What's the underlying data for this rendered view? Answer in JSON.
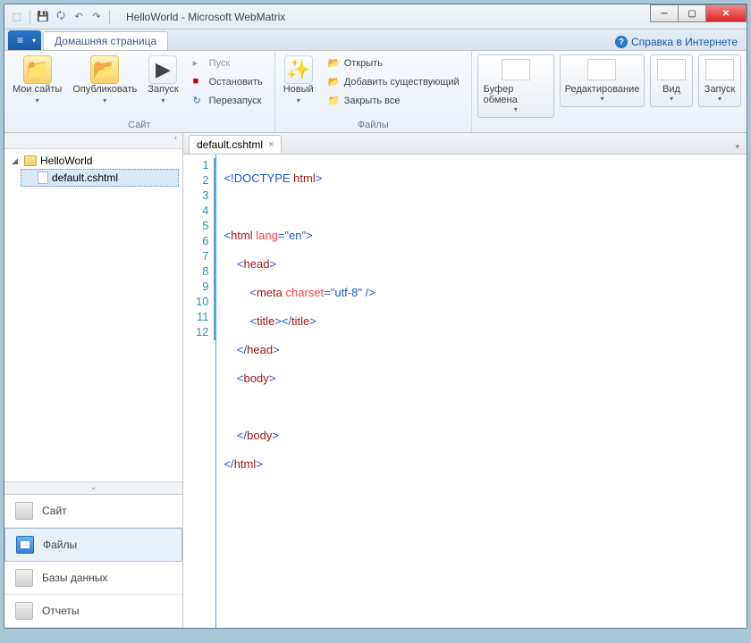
{
  "title": "HelloWorld - Microsoft WebMatrix",
  "ribbon_tab": "Домашняя страница",
  "help": "Справка в Интернете",
  "groups": {
    "site": {
      "label": "Сайт",
      "my_sites": "Мои сайты",
      "publish": "Опубликовать",
      "run": "Запуск",
      "start": "Пуск",
      "stop": "Остановить",
      "restart": "Перезапуск"
    },
    "files": {
      "label": "Файлы",
      "new": "Новый",
      "open": "Открыть",
      "add_existing": "Добавить существующий",
      "close_all": "Закрыть все"
    },
    "clipboard": "Буфер обмена",
    "editing": "Редактирование",
    "view": "Вид",
    "launch": "Запуск"
  },
  "tree": {
    "root": "HelloWorld",
    "file": "default.cshtml"
  },
  "nav": {
    "site": "Сайт",
    "files": "Файлы",
    "db": "Базы данных",
    "reports": "Отчеты"
  },
  "tab": {
    "name": "default.cshtml"
  },
  "code": {
    "lines": [
      "1",
      "2",
      "3",
      "4",
      "5",
      "6",
      "7",
      "8",
      "9",
      "10",
      "11",
      "12"
    ],
    "l1_a": "<!",
    "l1_b": "DOCTYPE",
    "l1_c": " html",
    "l1_d": ">",
    "l3_a": "<",
    "l3_b": "html",
    "l3_c": " lang",
    "l3_d": "=",
    "l3_e": "\"en\"",
    "l3_f": ">",
    "l4_a": "    <",
    "l4_b": "head",
    "l4_c": ">",
    "l5_a": "        <",
    "l5_b": "meta",
    "l5_c": " charset",
    "l5_d": "=",
    "l5_e": "\"utf-8\"",
    "l5_f": " />",
    "l6_a": "        <",
    "l6_b": "title",
    "l6_c": "></",
    "l6_d": "title",
    "l6_e": ">",
    "l7_a": "    </",
    "l7_b": "head",
    "l7_c": ">",
    "l8_a": "    <",
    "l8_b": "body",
    "l8_c": ">",
    "l10_a": "    </",
    "l10_b": "body",
    "l10_c": ">",
    "l11_a": "</",
    "l11_b": "html",
    "l11_c": ">"
  }
}
